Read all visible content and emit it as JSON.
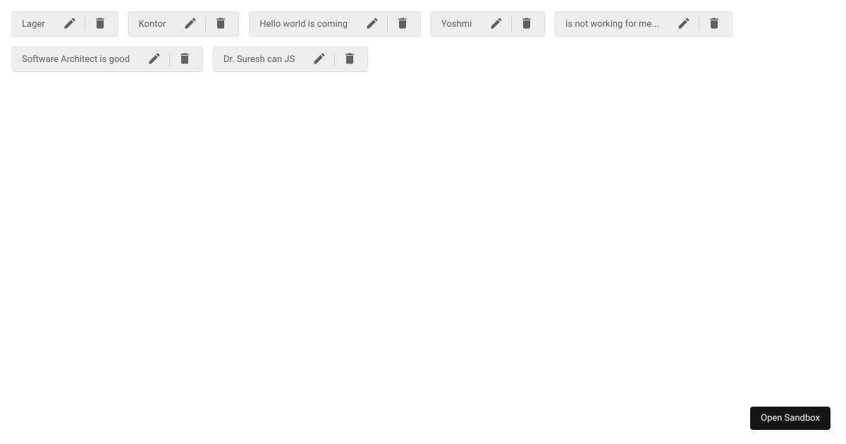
{
  "chips": [
    {
      "label": "Lager"
    },
    {
      "label": "Kontor"
    },
    {
      "label": "Hello world is coming"
    },
    {
      "label": "Yoshmi"
    },
    {
      "label": "is not working for me..."
    },
    {
      "label": "Software Architect is good"
    },
    {
      "label": "Dr. Suresh can JS"
    }
  ],
  "footer": {
    "open_sandbox_label": "Open Sandbox"
  },
  "icons": {
    "edit": "pencil-icon",
    "delete": "trash-icon"
  }
}
